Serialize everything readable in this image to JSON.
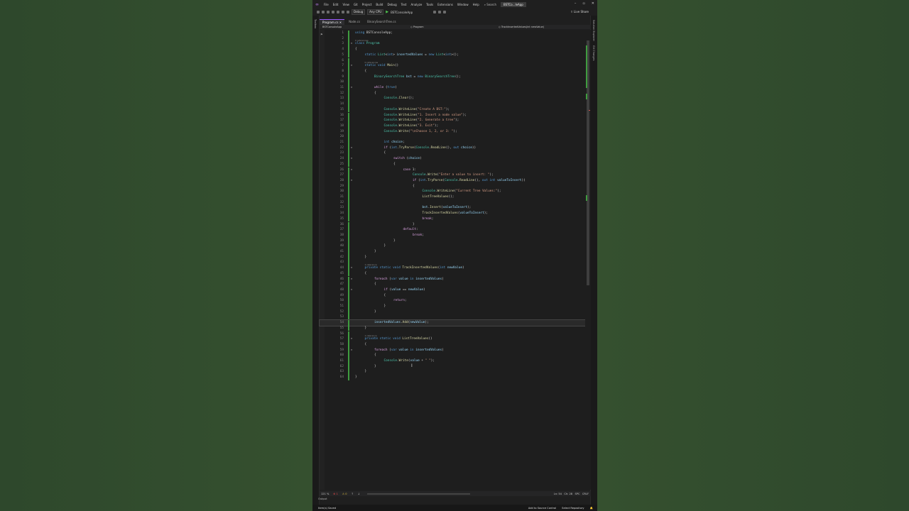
{
  "menu": {
    "items": [
      "File",
      "Edit",
      "View",
      "Git",
      "Project",
      "Build",
      "Debug",
      "Test",
      "Analyze",
      "Tools",
      "Extensions",
      "Window",
      "Help"
    ],
    "search": "Search",
    "solution": "BSTCo...leApp"
  },
  "toolbar": {
    "config": "Debug",
    "platform": "Any CPU",
    "start": "BSTConsoleApp",
    "live_share": "Live Share"
  },
  "side_panels": {
    "left": "Toolbox",
    "right_1": "Solution Explorer",
    "right_2": "Git Changes"
  },
  "tabs": [
    "Program.cs",
    "Node.cs",
    "BinarySearchTree.cs"
  ],
  "nav": {
    "project": "BSTConsoleApp",
    "type": "Program",
    "member": "TrackInsertedValues(int newValue)"
  },
  "editor": {
    "current_line": 54,
    "lines": [
      {
        "n": "1",
        "i": 0,
        "c": [
          [
            "kw",
            "using "
          ],
          [
            "tx",
            "BSTConsoleApp;"
          ]
        ]
      },
      {
        "n": "2",
        "i": 0,
        "c": []
      },
      {
        "n": "3",
        "i": 0,
        "refs": "0 references",
        "fold": "⊟",
        "c": [
          [
            "kw",
            "class "
          ],
          [
            "ty",
            "Program"
          ]
        ]
      },
      {
        "n": "4",
        "i": 0,
        "c": [
          [
            "tx",
            "{"
          ]
        ]
      },
      {
        "n": "5",
        "i": 1,
        "c": [
          [
            "kw",
            "static "
          ],
          [
            "ty",
            "List"
          ],
          [
            "tx",
            "<"
          ],
          [
            "kw",
            "int"
          ],
          [
            "tx",
            "> "
          ],
          [
            "vr",
            "insertedValues"
          ],
          [
            "tx",
            " = "
          ],
          [
            "kw",
            "new "
          ],
          [
            "ty",
            "List"
          ],
          [
            "tx",
            "<"
          ],
          [
            "kw",
            "int"
          ],
          [
            "tx",
            ">();"
          ]
        ]
      },
      {
        "n": "6",
        "i": 0,
        "c": []
      },
      {
        "n": "7",
        "i": 1,
        "refs": "0 references",
        "fold": "⊟",
        "c": [
          [
            "kw",
            "static void "
          ],
          [
            "mt",
            "Main"
          ],
          [
            "tx",
            "()"
          ]
        ]
      },
      {
        "n": "8",
        "i": 1,
        "c": [
          [
            "tx",
            "{"
          ]
        ]
      },
      {
        "n": "9",
        "i": 2,
        "c": [
          [
            "ty",
            "BinarySearchTree"
          ],
          [
            "tx",
            " "
          ],
          [
            "vr",
            "bst"
          ],
          [
            "tx",
            " = "
          ],
          [
            "kw",
            "new "
          ],
          [
            "ty",
            "BinarySearchTree"
          ],
          [
            "tx",
            "();"
          ]
        ]
      },
      {
        "n": "10",
        "i": 0,
        "c": []
      },
      {
        "n": "11",
        "i": 2,
        "fold": "⊟",
        "c": [
          [
            "ctl",
            "while "
          ],
          [
            "tx",
            "("
          ],
          [
            "kw",
            "true"
          ],
          [
            "tx",
            ")"
          ]
        ]
      },
      {
        "n": "12",
        "i": 2,
        "c": [
          [
            "tx",
            "{"
          ]
        ]
      },
      {
        "n": "13",
        "i": 3,
        "c": [
          [
            "ty",
            "Console"
          ],
          [
            "tx",
            "."
          ],
          [
            "mt",
            "Clear"
          ],
          [
            "tx",
            "();"
          ]
        ]
      },
      {
        "n": "14",
        "i": 0,
        "c": []
      },
      {
        "n": "15",
        "i": 3,
        "c": [
          [
            "ty",
            "Console"
          ],
          [
            "tx",
            "."
          ],
          [
            "mt",
            "WriteLine"
          ],
          [
            "tx",
            "("
          ],
          [
            "st",
            "\"Create A BST:\""
          ],
          [
            "tx",
            ");"
          ]
        ]
      },
      {
        "n": "16",
        "i": 3,
        "c": [
          [
            "ty",
            "Console"
          ],
          [
            "tx",
            "."
          ],
          [
            "mt",
            "WriteLine"
          ],
          [
            "tx",
            "("
          ],
          [
            "st",
            "\"1. Insert a node value\""
          ],
          [
            "tx",
            ");"
          ]
        ]
      },
      {
        "n": "17",
        "i": 3,
        "c": [
          [
            "ty",
            "Console"
          ],
          [
            "tx",
            "."
          ],
          [
            "mt",
            "WriteLine"
          ],
          [
            "tx",
            "("
          ],
          [
            "st",
            "\"2. Generate a tree\""
          ],
          [
            "tx",
            ");"
          ]
        ]
      },
      {
        "n": "18",
        "i": 3,
        "c": [
          [
            "ty",
            "Console"
          ],
          [
            "tx",
            "."
          ],
          [
            "mt",
            "WriteLine"
          ],
          [
            "tx",
            "("
          ],
          [
            "st",
            "\"3. Exit\""
          ],
          [
            "tx",
            ");"
          ]
        ]
      },
      {
        "n": "19",
        "i": 3,
        "c": [
          [
            "ty",
            "Console"
          ],
          [
            "tx",
            "."
          ],
          [
            "mt",
            "Write"
          ],
          [
            "tx",
            "("
          ],
          [
            "st",
            "\"\\nChoose 1, 2, or 3: \""
          ],
          [
            "tx",
            ");"
          ]
        ]
      },
      {
        "n": "20",
        "i": 0,
        "c": []
      },
      {
        "n": "21",
        "i": 3,
        "c": [
          [
            "kw",
            "int "
          ],
          [
            "vr",
            "choice"
          ],
          [
            "tx",
            ";"
          ]
        ]
      },
      {
        "n": "22",
        "i": 3,
        "fold": "⊟",
        "c": [
          [
            "ctl",
            "if "
          ],
          [
            "tx",
            "("
          ],
          [
            "kw",
            "int"
          ],
          [
            "tx",
            "."
          ],
          [
            "mt",
            "TryParse"
          ],
          [
            "tx",
            "("
          ],
          [
            "ty",
            "Console"
          ],
          [
            "tx",
            "."
          ],
          [
            "mt",
            "ReadLine"
          ],
          [
            "tx",
            "(), "
          ],
          [
            "kw",
            "out "
          ],
          [
            "vr",
            "choice"
          ],
          [
            "tx",
            "))"
          ]
        ]
      },
      {
        "n": "23",
        "i": 3,
        "c": [
          [
            "tx",
            "{"
          ]
        ]
      },
      {
        "n": "24",
        "i": 4,
        "fold": "⊟",
        "c": [
          [
            "ctl",
            "switch "
          ],
          [
            "tx",
            "("
          ],
          [
            "vr",
            "choice"
          ],
          [
            "tx",
            ")"
          ]
        ]
      },
      {
        "n": "25",
        "i": 4,
        "c": [
          [
            "tx",
            "{"
          ]
        ]
      },
      {
        "n": "26",
        "i": 5,
        "fold": "⊟",
        "c": [
          [
            "ctl",
            "case "
          ],
          [
            "tx",
            "1:"
          ]
        ]
      },
      {
        "n": "27",
        "i": 6,
        "c": [
          [
            "ty",
            "Console"
          ],
          [
            "tx",
            "."
          ],
          [
            "mt",
            "Write"
          ],
          [
            "tx",
            "("
          ],
          [
            "st",
            "\"Enter a value to insert: \""
          ],
          [
            "tx",
            ");"
          ]
        ]
      },
      {
        "n": "28",
        "i": 6,
        "fold": "⊟",
        "c": [
          [
            "ctl",
            "if "
          ],
          [
            "tx",
            "("
          ],
          [
            "kw",
            "int"
          ],
          [
            "tx",
            "."
          ],
          [
            "mt",
            "TryParse"
          ],
          [
            "tx",
            "("
          ],
          [
            "ty",
            "Console"
          ],
          [
            "tx",
            "."
          ],
          [
            "mt",
            "ReadLine"
          ],
          [
            "tx",
            "(), "
          ],
          [
            "kw",
            "out int "
          ],
          [
            "vr",
            "valueToInsert"
          ],
          [
            "tx",
            "))"
          ]
        ]
      },
      {
        "n": "29",
        "i": 6,
        "c": [
          [
            "tx",
            "{"
          ]
        ]
      },
      {
        "n": "30",
        "i": 7,
        "c": [
          [
            "ty",
            "Console"
          ],
          [
            "tx",
            "."
          ],
          [
            "mt",
            "WriteLine"
          ],
          [
            "tx",
            "("
          ],
          [
            "st",
            "\"Current Tree Values:\""
          ],
          [
            "tx",
            ");"
          ]
        ]
      },
      {
        "n": "31",
        "i": 7,
        "c": [
          [
            "mt",
            "ListTreeValues"
          ],
          [
            "tx",
            "();"
          ]
        ]
      },
      {
        "n": "32",
        "i": 0,
        "c": []
      },
      {
        "n": "33",
        "i": 7,
        "c": [
          [
            "vr",
            "bst"
          ],
          [
            "tx",
            "."
          ],
          [
            "mt",
            "Insert"
          ],
          [
            "tx",
            "("
          ],
          [
            "vr",
            "valueToInsert"
          ],
          [
            "tx",
            ");"
          ]
        ]
      },
      {
        "n": "34",
        "i": 7,
        "c": [
          [
            "mt",
            "TrackInsertedValues"
          ],
          [
            "tx",
            "("
          ],
          [
            "vr",
            "valueToInsert"
          ],
          [
            "tx",
            ");"
          ]
        ]
      },
      {
        "n": "35",
        "i": 7,
        "c": [
          [
            "ctl",
            "break"
          ],
          [
            "tx",
            ";"
          ]
        ]
      },
      {
        "n": "36",
        "i": 6,
        "c": [
          [
            "tx",
            "}"
          ]
        ]
      },
      {
        "n": "37",
        "i": 5,
        "c": [
          [
            "ctl",
            "default"
          ],
          [
            "tx",
            ":"
          ]
        ]
      },
      {
        "n": "38",
        "i": 6,
        "c": [
          [
            "ctl",
            "break"
          ],
          [
            "tx",
            ";"
          ]
        ]
      },
      {
        "n": "39",
        "i": 4,
        "c": [
          [
            "tx",
            "}"
          ]
        ]
      },
      {
        "n": "40",
        "i": 3,
        "c": [
          [
            "tx",
            "}"
          ]
        ]
      },
      {
        "n": "41",
        "i": 2,
        "c": [
          [
            "tx",
            "}"
          ]
        ]
      },
      {
        "n": "42",
        "i": 1,
        "c": [
          [
            "tx",
            "}"
          ]
        ]
      },
      {
        "n": "43",
        "i": 0,
        "c": []
      },
      {
        "n": "44",
        "i": 1,
        "refs": "1 reference",
        "fold": "⊟",
        "c": [
          [
            "kw",
            "private static void "
          ],
          [
            "mt",
            "TrackInsertedValues"
          ],
          [
            "tx",
            "("
          ],
          [
            "kw",
            "int "
          ],
          [
            "vr",
            "newValue"
          ],
          [
            "tx",
            ")"
          ]
        ]
      },
      {
        "n": "45",
        "i": 1,
        "c": [
          [
            "tx",
            "{"
          ]
        ]
      },
      {
        "n": "46",
        "i": 2,
        "fold": "⊟",
        "c": [
          [
            "ctl",
            "foreach "
          ],
          [
            "tx",
            "("
          ],
          [
            "kw",
            "var "
          ],
          [
            "vr",
            "value"
          ],
          [
            "tx",
            " "
          ],
          [
            "kw",
            "in "
          ],
          [
            "vr",
            "insertedValues"
          ],
          [
            "tx",
            ")"
          ]
        ]
      },
      {
        "n": "47",
        "i": 2,
        "c": [
          [
            "tx",
            "{"
          ]
        ]
      },
      {
        "n": "48",
        "i": 3,
        "fold": "⊟",
        "c": [
          [
            "ctl",
            "if "
          ],
          [
            "tx",
            "("
          ],
          [
            "vr",
            "value"
          ],
          [
            "tx",
            " == "
          ],
          [
            "vr",
            "newValue"
          ],
          [
            "tx",
            ")"
          ]
        ]
      },
      {
        "n": "49",
        "i": 3,
        "c": [
          [
            "tx",
            "{"
          ]
        ]
      },
      {
        "n": "50",
        "i": 4,
        "c": [
          [
            "ctl",
            "return"
          ],
          [
            "tx",
            ";"
          ]
        ]
      },
      {
        "n": "51",
        "i": 3,
        "c": [
          [
            "tx",
            "}"
          ]
        ]
      },
      {
        "n": "52",
        "i": 2,
        "c": [
          [
            "tx",
            "}"
          ]
        ]
      },
      {
        "n": "53",
        "i": 0,
        "c": []
      },
      {
        "n": "54",
        "i": 2,
        "c": [
          [
            "vr",
            "insertedValues"
          ],
          [
            "tx",
            "."
          ],
          [
            "mt",
            "Add"
          ],
          [
            "tx",
            "("
          ],
          [
            "vr",
            "newValue"
          ],
          [
            "tx",
            ");"
          ]
        ]
      },
      {
        "n": "55",
        "i": 1,
        "c": [
          [
            "tx",
            "}"
          ]
        ]
      },
      {
        "n": "56",
        "i": 0,
        "c": []
      },
      {
        "n": "57",
        "i": 1,
        "refs": "1 reference",
        "fold": "⊟",
        "c": [
          [
            "kw",
            "private static void "
          ],
          [
            "mt",
            "ListTreeValues"
          ],
          [
            "tx",
            "()"
          ]
        ]
      },
      {
        "n": "58",
        "i": 1,
        "c": [
          [
            "tx",
            "{"
          ]
        ]
      },
      {
        "n": "59",
        "i": 2,
        "fold": "⊟",
        "c": [
          [
            "ctl",
            "foreach "
          ],
          [
            "tx",
            "("
          ],
          [
            "kw",
            "var "
          ],
          [
            "vr",
            "value"
          ],
          [
            "tx",
            " "
          ],
          [
            "kw",
            "in "
          ],
          [
            "vr",
            "insertedValues"
          ],
          [
            "tx",
            ")"
          ]
        ]
      },
      {
        "n": "60",
        "i": 2,
        "c": [
          [
            "tx",
            "{"
          ]
        ]
      },
      {
        "n": "61",
        "i": 3,
        "c": [
          [
            "ty",
            "Console"
          ],
          [
            "tx",
            "."
          ],
          [
            "mt",
            "Write"
          ],
          [
            "tx",
            "("
          ],
          [
            "vr",
            "value"
          ],
          [
            "tx",
            " + "
          ],
          [
            "st",
            "\" \""
          ],
          [
            "tx",
            ");"
          ]
        ]
      },
      {
        "n": "62",
        "i": 2,
        "c": [
          [
            "tx",
            "}"
          ]
        ]
      },
      {
        "n": "63",
        "i": 1,
        "c": [
          [
            "tx",
            "}"
          ]
        ]
      },
      {
        "n": "64",
        "i": 0,
        "c": [
          [
            "tx",
            "}"
          ]
        ]
      }
    ]
  },
  "editor_status": {
    "zoom": "121 %",
    "errors": "1",
    "warnings": "0",
    "line": "Ln: 54",
    "col": "Ch: 28",
    "ws": "SPC",
    "eol": "CRLF"
  },
  "output_label": "Output",
  "status": {
    "left": "Item(s) Saved",
    "add_source": "Add to Source Control",
    "repo": "Select Repository"
  }
}
